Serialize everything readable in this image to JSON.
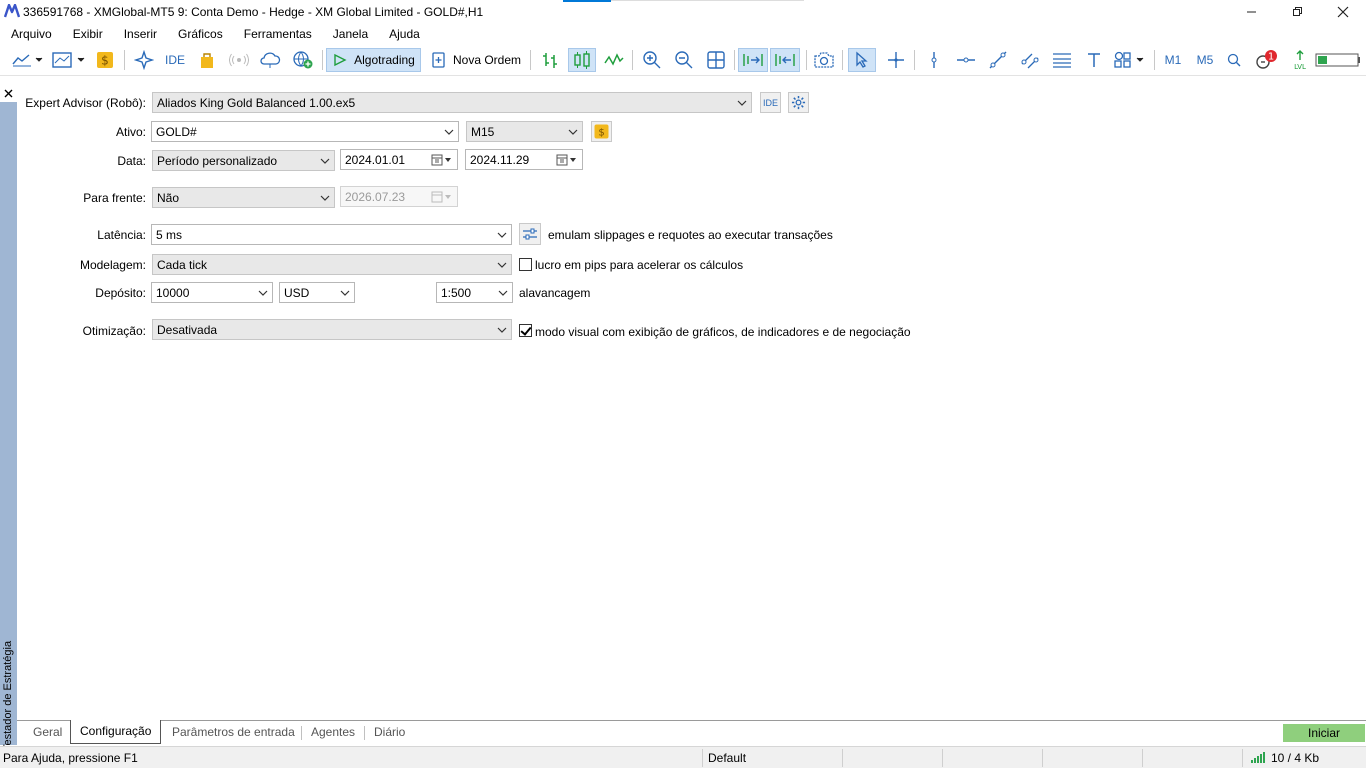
{
  "window": {
    "title": "336591768 - XMGlobal-MT5 9: Conta Demo - Hedge - XM Global Limited - GOLD#,H1"
  },
  "menu": [
    "Arquivo",
    "Exibir",
    "Inserir",
    "Gráficos",
    "Ferramentas",
    "Janela",
    "Ajuda"
  ],
  "toolbar": {
    "ide_label": "IDE",
    "algotrading_label": "Algotrading",
    "new_order_label": "Nova Ordem",
    "tf_m1": "M1",
    "tf_m5": "M5",
    "notification_count": "1",
    "lvl_label": "LVL"
  },
  "side_panel": {
    "label": "Testador de Estratégia"
  },
  "form": {
    "expert_label": "Expert Advisor (Robô):",
    "expert_value": "Aliados King Gold Balanced 1.00.ex5",
    "ide_btn": "IDE",
    "symbol_label": "Ativo:",
    "symbol_value": "GOLD#",
    "timeframe_value": "M15",
    "date_label": "Data:",
    "date_mode": "Período personalizado",
    "date_from": "2024.01.01",
    "date_to": "2024.11.29",
    "forward_label": "Para frente:",
    "forward_value": "Não",
    "forward_date": "2026.07.23",
    "latency_label": "Latência:",
    "latency_value": "5 ms",
    "latency_note": "emulam slippages e requotes ao executar transações",
    "model_label": "Modelagem:",
    "model_value": "Cada tick",
    "pips_note": "lucro em pips para acelerar os cálculos",
    "pips_checked": false,
    "deposit_label": "Depósito:",
    "deposit_value": "10000",
    "currency_value": "USD",
    "leverage_value": "1:500",
    "leverage_label": "alavancagem",
    "optimization_label": "Otimização:",
    "optimization_value": "Desativada",
    "visual_note": "modo visual com exibição de gráficos, de indicadores e de negociação",
    "visual_checked": true
  },
  "tabs": [
    "Geral",
    "Configuração",
    "Parâmetros de entrada",
    "Agentes",
    "Diário"
  ],
  "active_tab": "Configuração",
  "start_button": "Iniciar",
  "status": {
    "help": "Para Ajuda, pressione F1",
    "profile": "Default",
    "traffic": "10 / 4 Kb"
  },
  "colors": {
    "accent_blue": "#2a6ab8",
    "start_green": "#8fcf7d",
    "side_panel": "#9fb6d3"
  }
}
